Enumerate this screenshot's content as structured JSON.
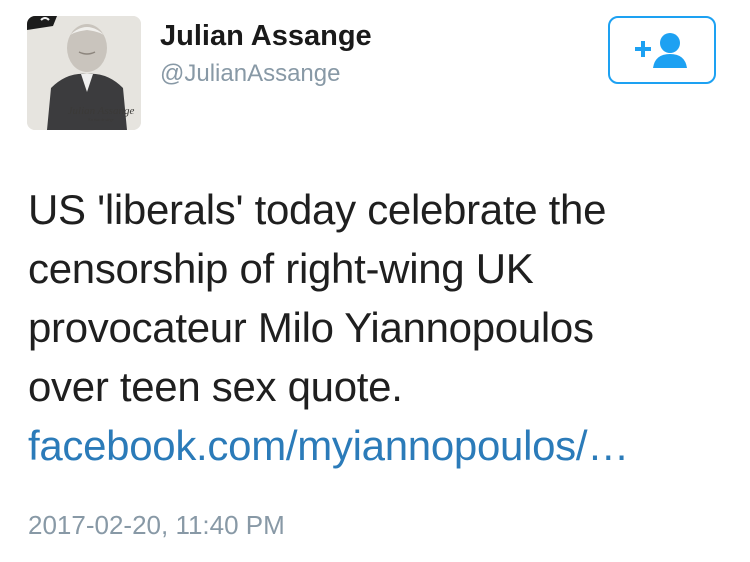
{
  "user": {
    "display_name": "Julian Assange",
    "handle": "@JulianAssange",
    "avatar_caption": "Julian Assange",
    "avatar_caption_sub": "En état de siège"
  },
  "follow_button": {
    "icon": "follow-person-plus-icon"
  },
  "tweet": {
    "lines": [
      "US 'liberals' today celebrate the",
      "censorship of right-wing UK",
      "provocateur Milo Yiannopoulos",
      "over teen sex quote."
    ],
    "link": "facebook.com/myiannopoulos/…"
  },
  "timestamp": "2017-02-20, 11:40 PM",
  "colors": {
    "link": "#2b7bb9",
    "follow_border": "#1da1f2",
    "muted": "#8899a6"
  }
}
